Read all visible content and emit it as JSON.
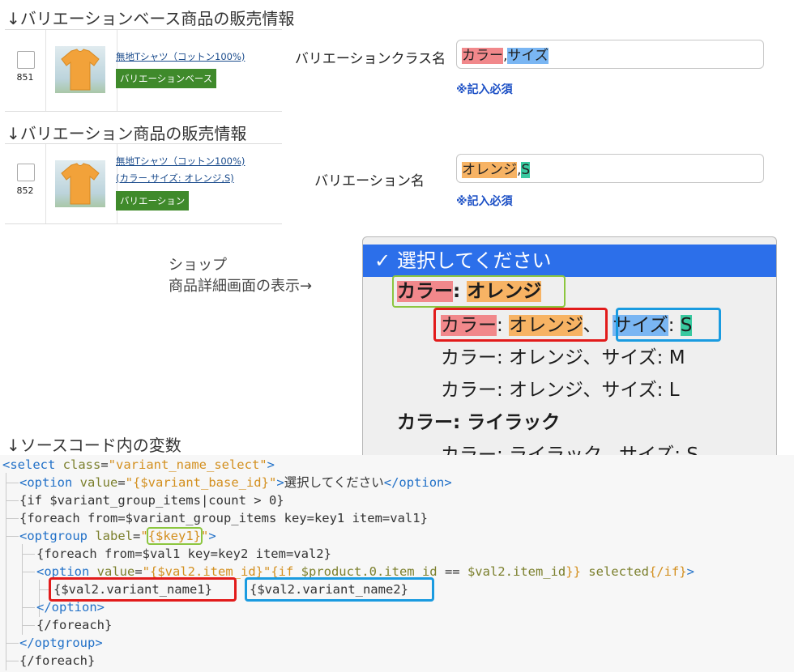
{
  "headings": {
    "base_info": "↓バリエーションベース商品の販売情報",
    "variant_info": "↓バリエーション商品の販売情報",
    "source_vars": "↓ソースコード内の変数"
  },
  "base_row": {
    "id": "851",
    "product_link": "無地Tシャツ（コットン100%)",
    "badge": "バリエーションベース",
    "field_label": "バリエーションクラス名",
    "field_parts": [
      "カラー",
      ",",
      "サイズ"
    ],
    "required": "※記入必須"
  },
  "variant_row": {
    "id": "852",
    "product_link_1": "無地Tシャツ（コットン100%)",
    "product_link_2": "(カラー,サイズ: オレンジ,S)",
    "badge": "バリエーション",
    "field_label": "バリエーション名",
    "field_parts": [
      "オレンジ",
      ",",
      "S"
    ],
    "required": "※記入必須"
  },
  "caption": {
    "line1": "ショップ",
    "line2": "商品詳細画面の表示→"
  },
  "dropdown": {
    "checkmark": "✓",
    "selected": "選択してください",
    "group1": {
      "key": "カラー",
      "sep": ": ",
      "value": "オレンジ"
    },
    "option1": {
      "name1_key": "カラー",
      "name1_sep": ": ",
      "name1_value": "オレンジ",
      "comma": "、",
      "name2_key": "サイズ",
      "name2_sep": ": ",
      "name2_value": "S"
    },
    "option2": "カラー: オレンジ、サイズ: M",
    "option3": "カラー: オレンジ、サイズ: L",
    "group2": "カラー: ライラック",
    "option4": "カラー: ライラック、サイズ: S"
  },
  "code": {
    "l1": {
      "a": "<select",
      "b": " class",
      "c": "=",
      "d": "\"variant_name_select\"",
      "e": ">"
    },
    "l2": {
      "a": "<option",
      "b": " value",
      "c": "=",
      "d": "\"{$variant_base_id}\"",
      "e": ">",
      "f": "選択してください",
      "g": "</option>"
    },
    "l3": "{if $variant_group_items|count > 0}",
    "l4": "{foreach from=$variant_group_items key=key1 item=val1}",
    "l5": {
      "a": "<optgroup",
      "b": " label",
      "c": "=",
      "d": "\"",
      "e": "{$key1}",
      "f": "\"",
      "g": ">"
    },
    "l6": "{foreach from=$val1 key=key2 item=val2}",
    "l7": {
      "a": "<option",
      "b": " value",
      "c": "=",
      "d": "\"{$val2.item_id}\"",
      "e": "{if ",
      "f": "$product.0.item_id",
      "g": " == ",
      "h": "$val2.item_id",
      "i": "}} ",
      "j": "selected",
      "k": "{/if}",
      "l": ">"
    },
    "l8": {
      "a": "{$val2.variant_name1}",
      "b": "{$val2.variant_name2}"
    },
    "l9": "</option>",
    "l10": "{/foreach}",
    "l11": "</optgroup>",
    "l12": "{/foreach}"
  },
  "colors": {
    "red": "#f1888b",
    "blue": "#7ab6f3",
    "orange": "#f7b364",
    "green": "#39c9a0",
    "box_red": "#e21b1b",
    "box_blue": "#1a9be0",
    "box_green": "#8cc63f",
    "select_blue": "#2c6fea",
    "badge_green": "#3f8a2b",
    "required_blue": "#1b4fc5"
  }
}
